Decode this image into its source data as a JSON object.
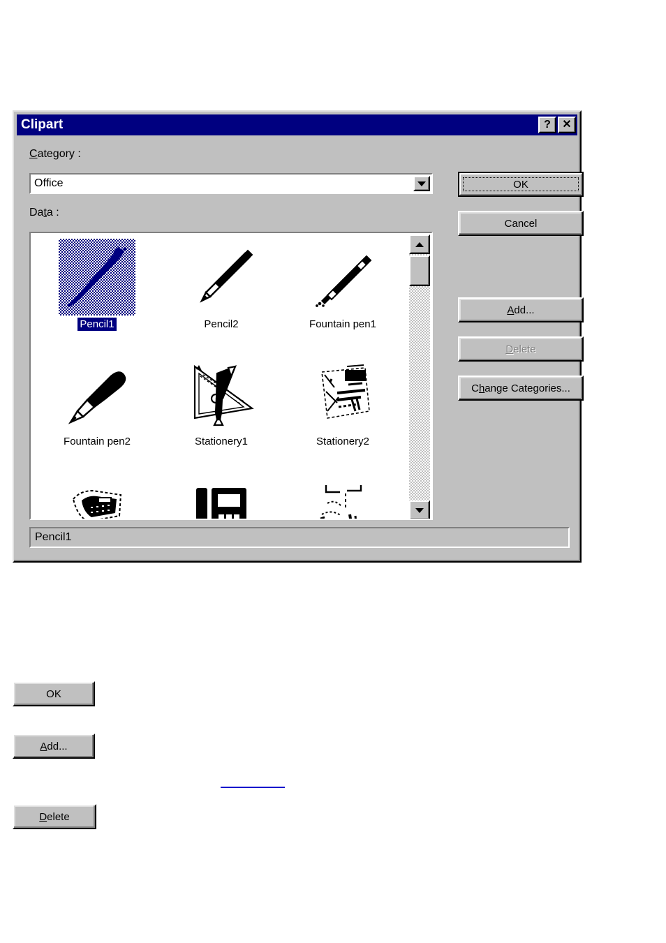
{
  "dialog": {
    "title": "Clipart",
    "titlebar_buttons": [
      {
        "name": "help",
        "glyph": "?"
      },
      {
        "name": "close",
        "glyph": "✕"
      }
    ],
    "category": {
      "label_prefix": "C",
      "label_rest": "ategory :",
      "value": "Office"
    },
    "data": {
      "label_a": "Da",
      "label_accel": "t",
      "label_b": "a :"
    },
    "items": [
      {
        "label": "Pencil1",
        "icon": "pencil-diagonal",
        "selected": true
      },
      {
        "label": "Pencil2",
        "icon": "pencil-short",
        "selected": false
      },
      {
        "label": "Fountain pen1",
        "icon": "fountain-pen-thin",
        "selected": false
      },
      {
        "label": "Fountain pen2",
        "icon": "fountain-pen-thick",
        "selected": false
      },
      {
        "label": "Stationery1",
        "icon": "triangle-ruler-pencil",
        "selected": false
      },
      {
        "label": "Stationery2",
        "icon": "desk-papers",
        "selected": false
      },
      {
        "label": "",
        "icon": "telephone-angled",
        "selected": false
      },
      {
        "label": "",
        "icon": "telephone-desk",
        "selected": false
      },
      {
        "label": "",
        "icon": "fax-machine",
        "selected": false
      }
    ],
    "status_text": "Pencil1",
    "buttons": {
      "ok": {
        "label": "OK",
        "default": true,
        "disabled": false
      },
      "cancel": {
        "label": "Cancel",
        "disabled": false
      },
      "add": {
        "accel": "A",
        "rest": "dd...",
        "disabled": false
      },
      "delete": {
        "accel": "D",
        "rest": "elete",
        "disabled": true
      },
      "change_categories": {
        "pre": "C",
        "accel": "h",
        "rest": "ange Categories...",
        "disabled": false
      }
    },
    "scrollbar": {
      "up_glyph": "up",
      "down_glyph": "down"
    }
  },
  "figures": {
    "ok_button": "OK",
    "add_button": {
      "accel": "A",
      "rest": "dd..."
    },
    "delete_button": {
      "accel": "D",
      "rest": "elete"
    }
  },
  "colors": {
    "titlebar": "#000080",
    "face": "#c0c0c0",
    "selection": "#000080",
    "rule": "#0000cc",
    "window": "#ffffff"
  }
}
